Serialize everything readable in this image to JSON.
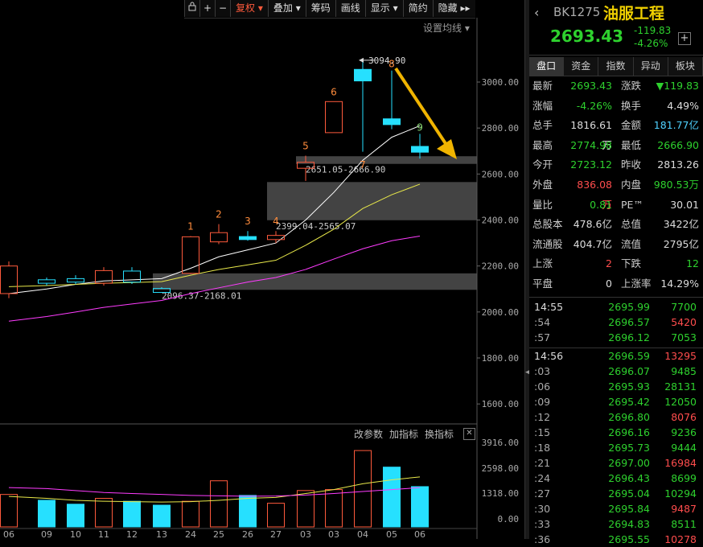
{
  "toolbar": {
    "items": [
      "复权",
      "叠加",
      "筹码",
      "画线",
      "显示",
      "简约",
      "隐藏"
    ],
    "lock_icon": "lock-icon",
    "plus_icon": "crosshair-plus-icon",
    "minus_icon": "minus-icon",
    "more_icon": "double-chevron-right-icon",
    "active_color": "#ff5a3c"
  },
  "ma_settings_label": "设置均线",
  "indicator_menu": {
    "items": [
      "改参数",
      "加指标",
      "换指标"
    ],
    "close_label": "✕"
  },
  "chart_data": [
    {
      "type": "candlestick",
      "title": "",
      "y_ticks": [
        "3000.00",
        "2800.00",
        "2600.00",
        "2400.00",
        "2200.00",
        "2000.00",
        "1800.00",
        "1600.00"
      ],
      "ylim": [
        1540,
        3220
      ],
      "x_tick_labels": [
        "06",
        "09",
        "10",
        "11",
        "12",
        "13",
        "24",
        "25",
        "26",
        "27",
        "03",
        "03",
        "04",
        "05",
        "06"
      ],
      "candles": [
        {
          "o": 2080,
          "c": 2200,
          "h": 2220,
          "l": 2060,
          "color": "#ff5a3c"
        },
        {
          "o": 2125,
          "c": 2140,
          "h": 2150,
          "l": 2115,
          "color": "#26e0ff"
        },
        {
          "o": 2130,
          "c": 2145,
          "h": 2160,
          "l": 2120,
          "color": "#26e0ff"
        },
        {
          "o": 2125,
          "c": 2180,
          "h": 2195,
          "l": 2115,
          "color": "#ff5a3c"
        },
        {
          "o": 2130,
          "c": 2178,
          "h": 2195,
          "l": 2122,
          "color": "#26e0ff"
        },
        {
          "o": 2085,
          "c": 2102,
          "h": 2108,
          "l": 2086,
          "color": "#26e0ff"
        },
        {
          "o": 2168,
          "c": 2327,
          "h": 2330,
          "l": 2165,
          "color": "#ff5a3c"
        },
        {
          "o": 2305,
          "c": 2345,
          "h": 2382,
          "l": 2295,
          "color": "#ff5a3c"
        },
        {
          "o": 2328,
          "c": 2315,
          "h": 2352,
          "l": 2310,
          "color": "#26e0ff"
        },
        {
          "o": 2315,
          "c": 2333,
          "h": 2352,
          "l": 2300,
          "color": "#ff5a3c"
        },
        {
          "o": 2625,
          "c": 2651,
          "h": 2680,
          "l": 2570,
          "color": "#ff5a3c"
        },
        {
          "o": 2780,
          "c": 2915,
          "h": 2915,
          "l": 2780,
          "color": "#ff5a3c"
        },
        {
          "o": 3055,
          "c": 3005,
          "h": 3095,
          "l": 2697,
          "color": "#26e0ff"
        },
        {
          "o": 2840,
          "c": 2815,
          "h": 3050,
          "l": 2795,
          "color": "#26e0ff"
        },
        {
          "o": 2720,
          "c": 2695,
          "h": 2775,
          "l": 2667,
          "color": "#26e0ff"
        }
      ],
      "ma_series": [
        {
          "color": "#ffffff",
          "values": [
            2080,
            2100,
            2120,
            2135,
            2140,
            2145,
            2190,
            2240,
            2270,
            2300,
            2400,
            2520,
            2660,
            2760,
            2810
          ]
        },
        {
          "color": "#e8e84a",
          "values": [
            2110,
            2115,
            2120,
            2125,
            2128,
            2132,
            2160,
            2185,
            2205,
            2225,
            2290,
            2360,
            2450,
            2510,
            2556
          ]
        },
        {
          "color": "#ff3cff",
          "values": [
            1960,
            1980,
            2000,
            2020,
            2035,
            2050,
            2080,
            2105,
            2130,
            2150,
            2185,
            2230,
            2275,
            2310,
            2330
          ]
        }
      ],
      "zones": [
        {
          "from": 2651.05,
          "to": 2666.9,
          "label": "2651.05-2666.90"
        },
        {
          "from": 2399.04,
          "to": 2565.07,
          "label": "2399.04-2565.07"
        },
        {
          "from": 2096.37,
          "to": 2168.01,
          "label": "2096.37-2168.01"
        }
      ],
      "count_labels": [
        "1",
        "2",
        "3",
        "4",
        "5",
        "6",
        "7",
        "8",
        "9"
      ],
      "peak_label": "3094.90",
      "peak_value": 3094.9
    },
    {
      "type": "bar",
      "y_ticks": [
        "3916.00",
        "2598.00",
        "1318.00",
        "0.00"
      ],
      "ylim": [
        0,
        4000
      ],
      "values": [
        1250,
        950,
        750,
        1050,
        900,
        700,
        900,
        1950,
        1200,
        800,
        1450,
        1500,
        3500,
        2650,
        1650
      ],
      "hollow": [
        true,
        false,
        false,
        true,
        false,
        false,
        true,
        true,
        false,
        true,
        true,
        true,
        true,
        false,
        false
      ],
      "colors": [
        "#ff5a3c",
        "#26e0ff",
        "#26e0ff",
        "#ff5a3c",
        "#26e0ff",
        "#26e0ff",
        "#ff5a3c",
        "#ff5a3c",
        "#26e0ff",
        "#ff5a3c",
        "#ff5a3c",
        "#ff5a3c",
        "#ff5a3c",
        "#26e0ff",
        "#26e0ff"
      ],
      "ma_series": [
        {
          "color": "#e8e84a",
          "values": [
            1150,
            1050,
            950,
            900,
            880,
            860,
            880,
            950,
            1050,
            1100,
            1300,
            1500,
            1800,
            2000,
            2150
          ]
        },
        {
          "color": "#ff3cff",
          "values": [
            1600,
            1550,
            1450,
            1350,
            1300,
            1250,
            1200,
            1180,
            1160,
            1170,
            1220,
            1300,
            1400,
            1500,
            1600
          ]
        }
      ]
    }
  ],
  "quote": {
    "back_icon": "back-arrow-icon",
    "code": "BK1275",
    "name": "油服工程",
    "price": "2693.43",
    "change": "-119.83",
    "change_pct": "-4.26%",
    "add_label": "+",
    "tabs": [
      "盘口",
      "资金",
      "指数",
      "异动",
      "板块"
    ],
    "rows": [
      [
        {
          "l": "最新",
          "v": "2693.43",
          "c": "g"
        },
        {
          "l": "涨跌",
          "v": "▼119.83",
          "c": "g"
        }
      ],
      [
        {
          "l": "涨幅",
          "v": "-4.26%",
          "c": "g"
        },
        {
          "l": "换手",
          "v": "4.49%",
          "c": "w"
        }
      ],
      [
        {
          "l": "总手",
          "v": "1816.61万",
          "c": "w"
        },
        {
          "l": "金额",
          "v": "181.77亿",
          "c": "c"
        }
      ],
      [
        {
          "l": "最高",
          "v": "2774.98",
          "c": "g"
        },
        {
          "l": "最低",
          "v": "2666.90",
          "c": "g"
        }
      ],
      [
        {
          "l": "今开",
          "v": "2723.12",
          "c": "g"
        },
        {
          "l": "昨收",
          "v": "2813.26",
          "c": "w"
        }
      ],
      [
        {
          "l": "外盘",
          "v": "836.08万",
          "c": "rd"
        },
        {
          "l": "内盘",
          "v": "980.53万",
          "c": "g"
        }
      ],
      [
        {
          "l": "量比",
          "v": "0.81",
          "c": "g"
        },
        {
          "l": "PE™",
          "v": "30.01",
          "c": "w"
        }
      ],
      [
        {
          "l": "总股本",
          "v": "478.6亿",
          "c": "w"
        },
        {
          "l": "总值",
          "v": "3422亿",
          "c": "w"
        }
      ],
      [
        {
          "l": "流通股",
          "v": "404.7亿",
          "c": "w"
        },
        {
          "l": "流值",
          "v": "2795亿",
          "c": "w"
        }
      ],
      [
        {
          "l": "上涨",
          "v": "2",
          "c": "rd"
        },
        {
          "l": "下跌",
          "v": "12",
          "c": "g"
        }
      ],
      [
        {
          "l": "平盘",
          "v": "0",
          "c": "w"
        },
        {
          "l": "上涨率",
          "v": "14.29%",
          "c": "w"
        }
      ]
    ],
    "ticks": [
      {
        "t": "14:55",
        "p": "2695.99",
        "v": "7700",
        "c": "g",
        "grp": true
      },
      {
        "t": ":54",
        "p": "2696.57",
        "v": "5420",
        "c": "rd"
      },
      {
        "t": ":57",
        "p": "2696.12",
        "v": "7053",
        "c": "g"
      },
      {
        "t": "14:56",
        "p": "2696.59",
        "v": "13295",
        "c": "rd",
        "grp": true
      },
      {
        "t": ":03",
        "p": "2696.07",
        "v": "9485",
        "c": "g"
      },
      {
        "t": ":06",
        "p": "2695.93",
        "v": "28131",
        "c": "g"
      },
      {
        "t": ":09",
        "p": "2695.42",
        "v": "12050",
        "c": "g"
      },
      {
        "t": ":12",
        "p": "2696.80",
        "v": "8076",
        "c": "rd"
      },
      {
        "t": ":15",
        "p": "2696.16",
        "v": "9236",
        "c": "g"
      },
      {
        "t": ":18",
        "p": "2695.73",
        "v": "9444",
        "c": "g"
      },
      {
        "t": ":21",
        "p": "2697.00",
        "v": "16984",
        "c": "rd"
      },
      {
        "t": ":24",
        "p": "2696.43",
        "v": "8699",
        "c": "g"
      },
      {
        "t": ":27",
        "p": "2695.04",
        "v": "10294",
        "c": "g"
      },
      {
        "t": ":30",
        "p": "2695.84",
        "v": "9487",
        "c": "rd"
      },
      {
        "t": ":33",
        "p": "2694.83",
        "v": "8511",
        "c": "g"
      },
      {
        "t": ":36",
        "p": "2695.55",
        "v": "10278",
        "c": "rd"
      }
    ]
  }
}
